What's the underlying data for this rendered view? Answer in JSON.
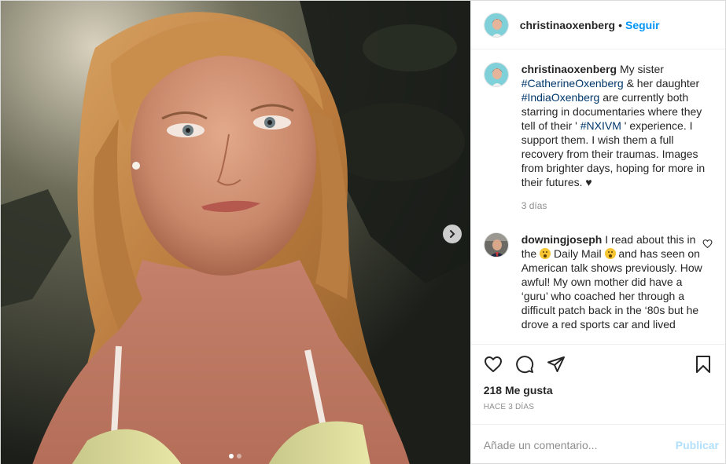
{
  "header": {
    "username": "christinaoxenberg",
    "separator": "•",
    "follow_label": "Seguir",
    "avatar_icon": "profile-avatar-icon"
  },
  "caption": {
    "username": "christinaoxenberg",
    "text_1": " My sister ",
    "tag_1": "#CatherineOxenberg",
    "text_2": " & her daughter ",
    "tag_2": "#IndiaOxenberg",
    "text_3": " are currently both starring in documentaries where they tell of their ' ",
    "tag_3": "#NXIVM",
    "text_4": " ' experience. I support them. I wish them a full recovery from their traumas. Images from brighter days, hoping for more in their futures. ",
    "end_glyph": "♥",
    "time": "3 días"
  },
  "comment": {
    "username": "downingjoseph",
    "text_1": " I read about this in the ",
    "text_2": " Daily Mail ",
    "text_3": " and has seen on American talk shows previously. How awful! My own mother did have a ‘guru’ who coached her through a difficult patch back in the ‘80s but he drove a red sports car and lived"
  },
  "actions": {
    "like_icon": "heart-icon",
    "comment_icon": "comment-icon",
    "share_icon": "send-icon",
    "save_icon": "bookmark-icon"
  },
  "likes": "218 Me gusta",
  "posted": "HACE 3 DÍAS",
  "add_comment": {
    "placeholder": "Añade un comentario...",
    "publish_label": "Publicar"
  },
  "carousel": {
    "next_icon": "chevron-right-icon",
    "current_index": 1,
    "total": 2
  },
  "colors": {
    "accent": "#0095f6",
    "hashtag": "#00376b",
    "muted": "#8e8e8e",
    "publish_disabled": "#b2dffc"
  }
}
